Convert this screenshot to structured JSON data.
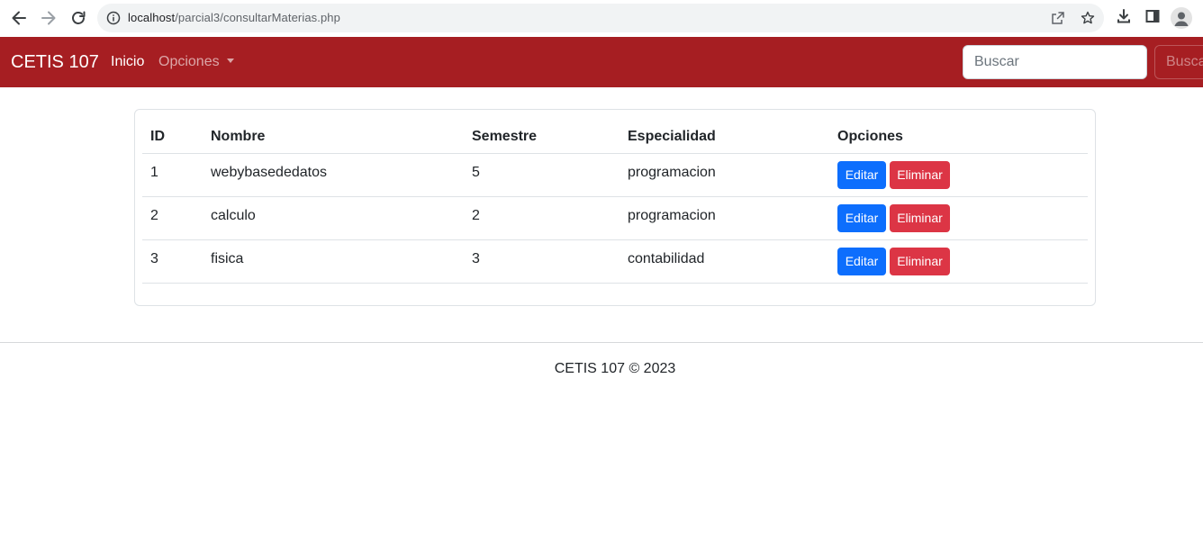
{
  "browser": {
    "url_host": "localhost",
    "url_path": "/parcial3/consultarMaterias.php",
    "icons": [
      "back-arrow-icon",
      "forward-arrow-icon",
      "reload-icon",
      "info-icon",
      "share-icon",
      "star-icon",
      "download-icon",
      "side-panel-icon",
      "profile-icon"
    ]
  },
  "navbar": {
    "brand": "CETIS 107",
    "links": [
      {
        "label": "Inicio"
      },
      {
        "label": "Opciones"
      }
    ],
    "search_placeholder": "Buscar",
    "search_button": "Buscar",
    "color": "#a61e22"
  },
  "table": {
    "headers": [
      "ID",
      "Nombre",
      "Semestre",
      "Especialidad",
      "Opciones"
    ],
    "rows": [
      {
        "id": "1",
        "nombre": "webybasededatos",
        "semestre": "5",
        "especialidad": "programacion",
        "edit": "Editar",
        "delete": "Eliminar"
      },
      {
        "id": "2",
        "nombre": "calculo",
        "semestre": "2",
        "especialidad": "programacion",
        "edit": "Editar",
        "delete": "Eliminar"
      },
      {
        "id": "3",
        "nombre": "fisica",
        "semestre": "3",
        "especialidad": "contabilidad",
        "edit": "Editar",
        "delete": "Eliminar"
      }
    ],
    "edit_color": "#0d6efd",
    "delete_color": "#dc3545"
  },
  "footer": {
    "text": "CETIS 107 © 2023"
  }
}
